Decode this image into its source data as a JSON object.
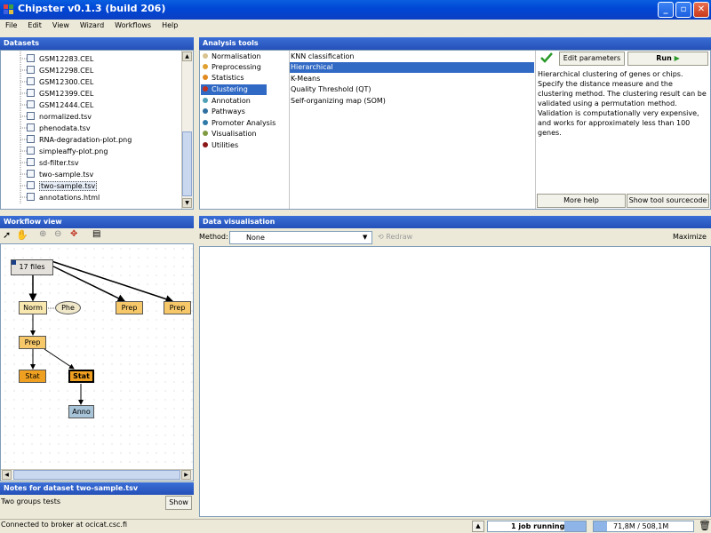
{
  "window": {
    "title": "Chipster v0.1.3 (build 206)"
  },
  "menu": [
    "File",
    "Edit",
    "View",
    "Wizard",
    "Workflows",
    "Help"
  ],
  "datasets": {
    "header": "Datasets",
    "files": [
      "GSM12283.CEL",
      "GSM12298.CEL",
      "GSM12300.CEL",
      "GSM12399.CEL",
      "GSM12444.CEL",
      "normalized.tsv",
      "phenodata.tsv",
      "RNA-degradation-plot.png",
      "simpleaffy-plot.png",
      "sd-filter.tsv",
      "two-sample.tsv",
      "two-sample.tsv",
      "annotations.html"
    ]
  },
  "analysis": {
    "header": "Analysis tools",
    "categories": [
      {
        "label": "Normalisation",
        "color": "#d8c38f"
      },
      {
        "label": "Preprocessing",
        "color": "#e0a030"
      },
      {
        "label": "Statistics",
        "color": "#e08a20"
      },
      {
        "label": "Clustering",
        "color": "#c03020"
      },
      {
        "label": "Annotation",
        "color": "#50a0b8"
      },
      {
        "label": "Pathways",
        "color": "#3070a0"
      },
      {
        "label": "Promoter Analysis",
        "color": "#2f7aa8"
      },
      {
        "label": "Visualisation",
        "color": "#7f9a40"
      },
      {
        "label": "Utilities",
        "color": "#8a1818"
      }
    ],
    "tools": [
      "KNN classification",
      "Hierarchical",
      "K-Means",
      "Quality Threshold (QT)",
      "Self-organizing map (SOM)"
    ],
    "edit_parameters": "Edit parameters",
    "run": "Run",
    "description": "Hierarchical clustering of genes or chips. Specify the distance measure and the clustering method. The clustering result can be validated using a permutation method. Validation is computationally very expensive, and works for approximately less than 100 genes.",
    "more_help": "More help",
    "show_source": "Show tool sourcecode"
  },
  "workflow": {
    "header": "Workflow view",
    "nodes": {
      "files": "17 files",
      "norm": "Norm",
      "phe": "Phe",
      "prep1": "Prep",
      "prep2": "Prep",
      "prep3": "Prep",
      "stat1": "Stat",
      "stat2": "Stat",
      "anno": "Anno"
    }
  },
  "notes": {
    "header": "Notes for dataset two-sample.tsv",
    "text": "Two groups tests",
    "show": "Show"
  },
  "visualisation": {
    "header": "Data visualisation",
    "method_label": "Method:",
    "method_value": "None",
    "redraw": "Redraw",
    "maximize": "Maximize"
  },
  "status": {
    "broker": "Connected to broker at ocicat.csc.fi",
    "jobs": "1 job running",
    "memory": "71,8M / 508,1M"
  },
  "colors": {
    "panel_header": "#2d5cc4",
    "selection": "#316ac5",
    "prep": "#f6c86a",
    "stat": "#f0a020",
    "anno": "#a8c4d8",
    "norm": "#f8e8b0"
  }
}
